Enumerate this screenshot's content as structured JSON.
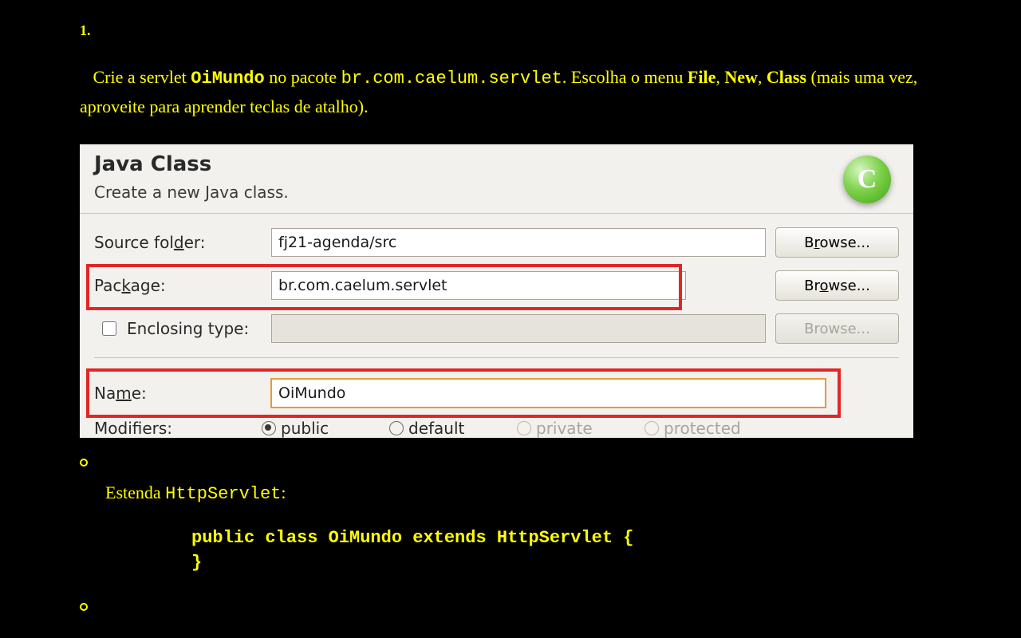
{
  "step_number": "1.",
  "instruction": {
    "t1": "Crie a servlet ",
    "servlet_name": "OiMundo",
    "t2": " no pacote ",
    "package_name": "br.com.caelum.servlet",
    "t3": ". Escolha o menu ",
    "menu1": "File",
    "sep1": ", ",
    "menu2": "New",
    "sep2": ", ",
    "menu3": "Class",
    "t4": " (mais uma vez, aproveite para aprender teclas de atalho)."
  },
  "dialog": {
    "title": "Java Class",
    "subtitle": "Create a new Java class.",
    "source_folder_label": "Source fol",
    "source_folder_label_u": "d",
    "source_folder_label2": "er:",
    "source_folder_value": "fj21-agenda/src",
    "package_label": "Pac",
    "package_label_u": "k",
    "package_label2": "age:",
    "package_value": "br.com.caelum.servlet",
    "enclosing_label": "Enclosing type:",
    "name_label": "Na",
    "name_label_u": "m",
    "name_label2": "e:",
    "name_value": "OiMundo",
    "modifiers_label": "Modifiers:",
    "mod_public": "public",
    "mod_default": "default",
    "mod_private": "private",
    "mod_protected": "protected",
    "browse": "Browse...",
    "browse_u": "r",
    "browse_u2": "o"
  },
  "sub_instruction": {
    "t1": "Estenda ",
    "class": "HttpServlet",
    "t2": ":"
  },
  "code": "public class OiMundo extends HttpServlet {\n}"
}
